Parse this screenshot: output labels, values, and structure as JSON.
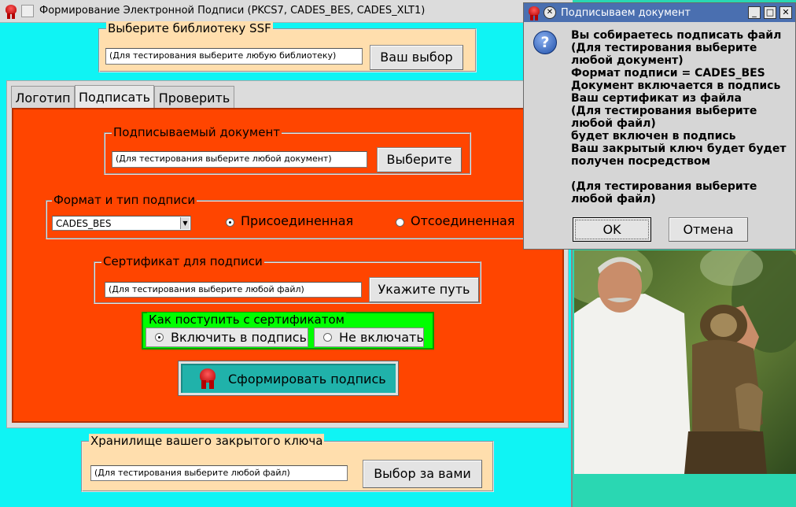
{
  "main_window": {
    "title": "Формирование Электронной Подписи (PKCS7, CADES_BES, CADES_XLT1)"
  },
  "library": {
    "legend": "Выберите библиотеку SSF",
    "placeholder": "(Для тестирования выберите любую библиотеку)",
    "button": "Ваш выбор"
  },
  "tabs": [
    {
      "label": "Логотип"
    },
    {
      "label": "Подписать"
    },
    {
      "label": "Проверить"
    }
  ],
  "document": {
    "legend": "Подписываемый документ",
    "placeholder": "(Для тестирования выберите любой документ)",
    "button": "Выберите"
  },
  "format": {
    "legend": "Формат и тип подписи",
    "selected": "CADES_BES",
    "options": [
      {
        "label": "Присоединенная",
        "checked": true
      },
      {
        "label": "Отсоединенная",
        "checked": false
      }
    ]
  },
  "certificate": {
    "legend": "Сертификат для подписи",
    "placeholder": "(Для тестирования выберите любой файл)",
    "button": "Укажите путь"
  },
  "cert_action": {
    "legend": "Как поступить с сертификатом",
    "options": [
      {
        "label": "Включить в подпись",
        "checked": true
      },
      {
        "label": "Не включать",
        "checked": false
      }
    ]
  },
  "sign_button": "Сформировать подпись",
  "keystore": {
    "legend": "Хранилище вашего закрытого ключа",
    "placeholder": "(Для тестирования выберите любой файл)",
    "button": "Выбор за вами"
  },
  "dialog": {
    "title": "Подписываем документ",
    "message": "Вы собираетесь подписать файл\n(Для тестирования выберите\nлюбой документ)\nФормат подписи = CADES_BES\nДокумент включается в подпись\nВаш сертификат из файла\n(Для тестирования выберите\nлюбой файл)\nбудет включен в подпись\nВаш закрытый ключ будет будет\nполучен посредством\n\n(Для тестирования выберите\nлюбой файл)",
    "ok_button": "OK",
    "cancel_button": "Отмена"
  },
  "colors": {
    "window_bg": "#00ffff",
    "tab_panel_bg": "#ff4500",
    "library_bg": "#ffdead",
    "cert_action_bg": "#00ff00",
    "sign_button_bg": "#20b2aa",
    "dialog_title_bg": "#4a6fb0"
  }
}
